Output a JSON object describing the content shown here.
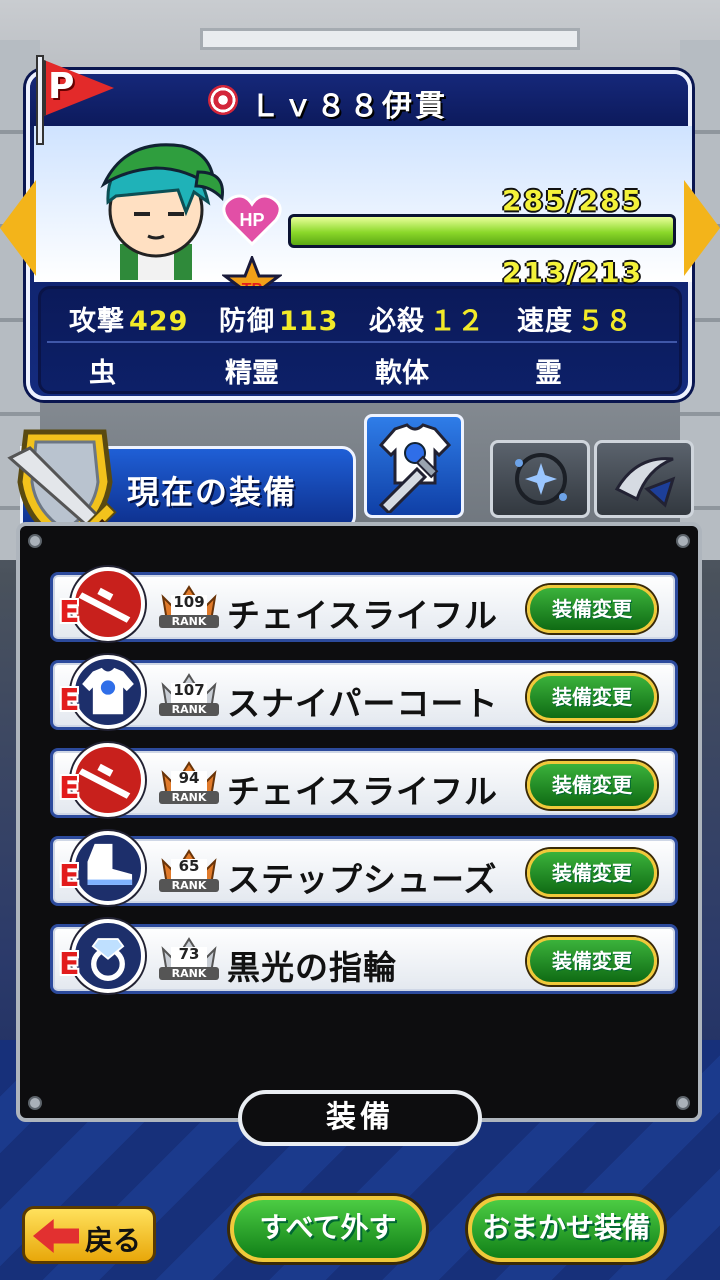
{
  "character": {
    "level_name": "Ｌｖ８８伊貫",
    "hp_label": "HP",
    "hp_value": "285/285",
    "hp_fraction": 1.0,
    "tp_label": "TP",
    "tp_value": "213/213",
    "tp_fraction": 1.0,
    "flag_letter": "P"
  },
  "stats": [
    {
      "label": "攻撃",
      "value": "429"
    },
    {
      "label": "防御",
      "value": "113"
    },
    {
      "label": "必殺",
      "value": "１２"
    },
    {
      "label": "速度",
      "value": "５８"
    }
  ],
  "traits": [
    "虫",
    "精霊",
    "軟体",
    "霊"
  ],
  "section": {
    "title": "現在の装備"
  },
  "equipment": [
    {
      "grade": "E",
      "icon": "rifle-icon",
      "icon_color": "#c8201c",
      "rank": "109",
      "rank_color": "#e07a2a",
      "name": "チェイスライフル",
      "button": "装備変更"
    },
    {
      "grade": "E",
      "icon": "coat-icon",
      "icon_color": "#1d2f6b",
      "rank": "107",
      "rank_color": "#c9ced5",
      "name": "スナイパーコート",
      "button": "装備変更"
    },
    {
      "grade": "E",
      "icon": "rifle-icon",
      "icon_color": "#c8201c",
      "rank": "94",
      "rank_color": "#e07a2a",
      "name": "チェイスライフル",
      "button": "装備変更"
    },
    {
      "grade": "E",
      "icon": "shoe-icon",
      "icon_color": "#1d2f6b",
      "rank": "65",
      "rank_color": "#e07a2a",
      "name": "ステップシューズ",
      "button": "装備変更"
    },
    {
      "grade": "E",
      "icon": "ring-icon",
      "icon_color": "#1d2f6b",
      "rank": "73",
      "rank_color": "#c9ced5",
      "name": "黒光の指輪",
      "button": "装備変更"
    }
  ],
  "rank_word": "RANK",
  "equip_label": "装備",
  "buttons": {
    "back": "戻る",
    "unequip_all": "すべて外す",
    "auto_equip": "おまかせ装備"
  }
}
